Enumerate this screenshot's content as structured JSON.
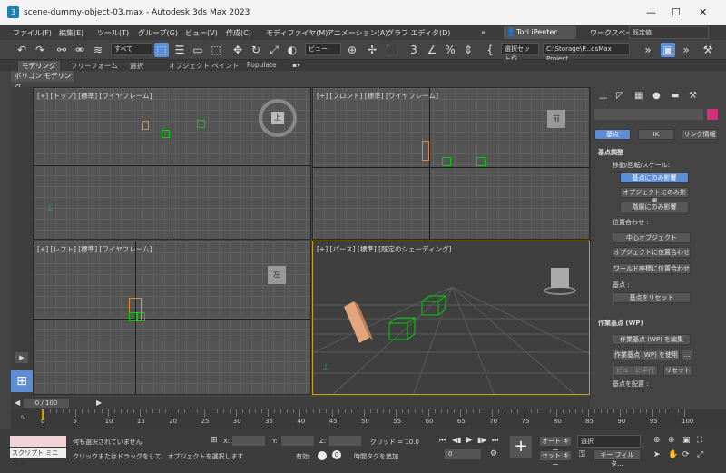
{
  "window": {
    "title": "scene-dummy-object-03.max - Autodesk 3ds Max 2023",
    "minimize": "—",
    "maximize": "☐",
    "close": "✕",
    "app_icon": "3ds"
  },
  "menu": [
    "ファイル(F)",
    "編集(E)",
    "ツール(T)",
    "グループ(G)",
    "ビュー(V)",
    "作成(C)",
    "モディファイヤ(M)",
    "アニメーション(A)",
    "グラフ エディタ(D)",
    "»"
  ],
  "user": {
    "name": "Tori iPentec",
    "workspace_label": "ワークスペース:",
    "workspace_value": "既定値"
  },
  "toolbar": {
    "selection_filter": "すべて",
    "view_ref": "ビュー",
    "selection_set": "選択セット作",
    "project_path": "C:\\Storage\\P...dsMax Project"
  },
  "ribbon": {
    "tabs": [
      "モデリング",
      "フリーフォーム",
      "選択",
      "オブジェクト ペイント",
      "Populate"
    ],
    "subtab": "ポリゴン モデリング"
  },
  "viewports": {
    "top": "[+] [トップ] [標準] [ワイヤフレーム]",
    "front": "[+] [フロント] [標準] [ワイヤフレーム]",
    "left": "[+] [レフト] [標準] [ワイヤフレーム]",
    "persp": "[+] [パース] [標準] [既定のシェーディング]",
    "viewcube_top": "上",
    "viewcube_front": "前",
    "viewcube_left": "左"
  },
  "command_panel": {
    "tabs": [
      "基点",
      "IK",
      "リンク情報"
    ],
    "section_pivot": "基点調整",
    "move_label": "移動/回転/スケール:",
    "pivot_only": "基点にのみ影響",
    "object_only": "オブジェクトにのみ影響",
    "hierarchy_only": "階層にのみ影響",
    "align_label": "位置合わせ :",
    "center_object": "中心オブジェクト",
    "align_object": "オブジェクトに位置合わせ",
    "align_world": "ワールド座標に位置合わせ",
    "pivot_label": "基点 :",
    "reset_pivot": "基点をリセット",
    "section_wp": "作業基点 (WP)",
    "edit_wp": "作業基点 (WP) を編集",
    "use_wp": "作業基点 (WP) を使用",
    "ellipsis": "...",
    "view_align": "ビューに平行",
    "reset": "リセット",
    "place_pivot": "基点を配置 :"
  },
  "track": {
    "frame": "0 / 100"
  },
  "timeline": {
    "ticks": [
      "0",
      "5",
      "10",
      "15",
      "20",
      "25",
      "30",
      "35",
      "40",
      "45",
      "50",
      "55",
      "60",
      "65",
      "70",
      "75",
      "80",
      "85",
      "90",
      "95",
      "100"
    ]
  },
  "status": {
    "script_mini": "スクリプト ミニ リス",
    "no_selection": "何も選択されていません",
    "hint": "クリックまたはドラッグをして、オブジェクトを選択します",
    "x_label": "X:",
    "y_label": "Y:",
    "z_label": "Z:",
    "grid": "グリッド = 10.0",
    "enabled_label": "有効:",
    "add_time_tag": "時間タグを追加",
    "auto_key": "オート キー",
    "set_key": "セット キー",
    "selection": "選択",
    "key_filter": "キー フィルタ...",
    "frame_value": "0"
  },
  "colors": {
    "accent": "#5d8ed3",
    "object_green": "#00d000",
    "object_orange": "#e08a3a",
    "title_bg": "#f3f3f3",
    "swatch": "#d2327a"
  }
}
